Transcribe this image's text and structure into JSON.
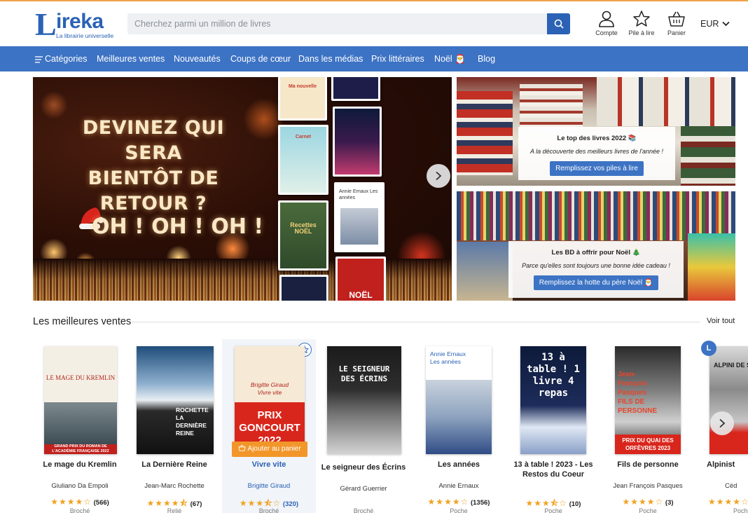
{
  "brand": {
    "name": "ireka",
    "initial": "L",
    "tagline": "La librairie universelle",
    "accent": "#2b62b5",
    "nav_color": "#3d73c4",
    "cta_color": "#f2962a"
  },
  "search": {
    "placeholder": "Cherchez parmi un million de livres",
    "icon": "search-icon"
  },
  "header_icons": [
    {
      "label": "Compte",
      "icon": "user-icon"
    },
    {
      "label": "Pile à lire",
      "icon": "star-icon"
    },
    {
      "label": "Panier",
      "icon": "basket-icon"
    }
  ],
  "currency": {
    "value": "EUR",
    "icon": "chevron-down-icon"
  },
  "nav": {
    "items": [
      "Catégories",
      "Meilleures ventes",
      "Nouveautés",
      "Coups de cœur",
      "Dans les médias",
      "Prix littéraires",
      "Noël 🎅",
      "Blog"
    ]
  },
  "hero": {
    "title": "DEVINEZ QUI SERA BIENTÔT DE RETOUR ?",
    "subtitle": "OH ! OH ! OH !",
    "books": [
      {
        "title": "Ma nouvelle"
      },
      {
        "title": "Carnet"
      },
      {
        "title": "Recettes NOËL"
      },
      {
        "title": "Annie Ernaux Les années"
      },
      {
        "title": "NOËL"
      }
    ]
  },
  "promos": [
    {
      "title": "Le top des livres 2022 📚",
      "subtitle": "A la découverte des meilleurs livres de l'année !",
      "button": "Remplissez vos piles à lire"
    },
    {
      "title": "Les BD à offrir pour Noël 🎄",
      "subtitle": "Parce qu'elles sont toujours une bonne idée cadeau !",
      "button": "Remplissez la hotte du père Noël 🎅"
    }
  ],
  "bestsellers": {
    "title": "Les meilleures ventes",
    "see_all": "Voir tout",
    "cart_label": "Ajouter au panier",
    "products": [
      {
        "title": "Le mage du Kremlin",
        "author": "Giuliano Da Empoli",
        "rating": 4,
        "reviews": "(566)",
        "format": "Broché",
        "cover_text": "LE MAGE DU KREMLIN",
        "badge": "GRAND PRIX DU ROMAN DE L'ACADÉMIE FRANÇAISE 2022"
      },
      {
        "title": "La Dernière Reine",
        "author": "Jean-Marc Rochette",
        "rating": 4.5,
        "reviews": "(67)",
        "format": "Relié",
        "cover_text": "ROCHETTE LA DERNIÈRE REINE"
      },
      {
        "title": "Vivre vite",
        "author": "Brigitte Giraud",
        "rating": 3.5,
        "reviews": "(320)",
        "format": "Broché",
        "cover_text": "Brigitte Giraud Vivre vite",
        "badge": "PRIX GONCOURT 2022"
      },
      {
        "title": "Le seigneur des Écrins",
        "author": "Gérard Guerrier",
        "rating": 0,
        "reviews": "",
        "format": "Broché",
        "cover_text": "LE SEIGNEUR DES ÉCRINS"
      },
      {
        "title": "Les années",
        "author": "Annie Ernaux",
        "rating": 4,
        "reviews": "(1356)",
        "format": "Poche",
        "cover_text": "Annie Ernaux Les années"
      },
      {
        "title": "13 à table ! 2023 - Les Restos du Coeur",
        "author": "",
        "rating": 3.5,
        "reviews": "(10)",
        "format": "Poche",
        "cover_text": "13 à table ! 1 livre 4 repas"
      },
      {
        "title": "Fils de personne",
        "author": "Jean François Pasques",
        "rating": 4,
        "reviews": "(3)",
        "format": "Poche",
        "cover_text": "Jean-François Pasques FILS DE PERSONNE",
        "badge": "PRIX DU QUAI DES ORFÈVRES 2023"
      },
      {
        "title": "Alpinist",
        "author": "Céd",
        "rating": 4,
        "reviews": "",
        "format": "Poche",
        "cover_text": "ALPINI DE STA"
      }
    ]
  }
}
